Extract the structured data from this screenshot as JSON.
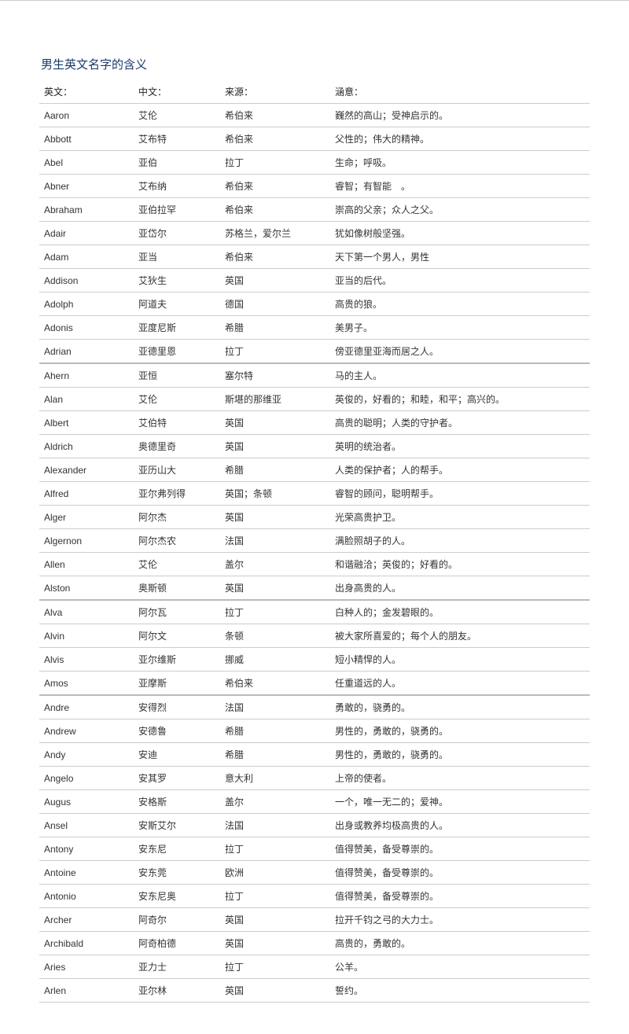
{
  "title": "男生英文名字的含义",
  "headers": {
    "en": "英文：",
    "cn": "中文：",
    "src": "来源：",
    "mean": "涵意："
  },
  "rows": [
    {
      "en": "Aaron",
      "cn": "艾伦",
      "src": "希伯来",
      "mean": "巍然的高山；受神启示的。",
      "sep": false
    },
    {
      "en": "Abbott",
      "cn": "艾布特",
      "src": "希伯来",
      "mean": "父性的；伟大的精神。",
      "sep": false
    },
    {
      "en": "Abel",
      "cn": "亚伯",
      "src": "拉丁",
      "mean": "生命；呼吸。",
      "sep": false
    },
    {
      "en": "Abner",
      "cn": "艾布纳",
      "src": "希伯来",
      "mean": "睿智；有智能　。",
      "sep": false
    },
    {
      "en": "Abraham",
      "cn": "亚伯拉罕",
      "src": "希伯来",
      "mean": "崇高的父亲；众人之父。",
      "sep": false
    },
    {
      "en": "Adair",
      "cn": "亚岱尔",
      "src": "苏格兰，爱尔兰",
      "mean": "犹如像树般坚强。",
      "sep": false
    },
    {
      "en": "Adam",
      "cn": "亚当",
      "src": "希伯来",
      "mean": "天下第一个男人，男性",
      "sep": false
    },
    {
      "en": "Addison",
      "cn": "艾狄生",
      "src": "英国",
      "mean": "亚当的后代。",
      "sep": false
    },
    {
      "en": "Adolph",
      "cn": "阿道夫",
      "src": "德国",
      "mean": "高贵的狼。",
      "sep": false
    },
    {
      "en": "Adonis",
      "cn": "亚度尼斯",
      "src": "希腊",
      "mean": "美男子。",
      "sep": false
    },
    {
      "en": "Adrian",
      "cn": "亚德里恩",
      "src": "拉丁",
      "mean": "傍亚德里亚海而居之人。",
      "sep": true
    },
    {
      "en": "Ahern",
      "cn": "亚恒",
      "src": "塞尔特",
      "mean": "马的主人。",
      "sep": false
    },
    {
      "en": "Alan",
      "cn": "艾伦",
      "src": "斯堪的那维亚",
      "mean": "英俊的，好看的；和睦，和平；高兴的。",
      "sep": false
    },
    {
      "en": "Albert",
      "cn": "艾伯特",
      "src": "英国",
      "mean": "高贵的聪明；人类的守护者。",
      "sep": false
    },
    {
      "en": "Aldrich",
      "cn": "奥德里奇",
      "src": "英国",
      "mean": "英明的统治者。",
      "sep": false
    },
    {
      "en": "Alexander",
      "cn": "亚历山大",
      "src": "希腊",
      "mean": "人类的保护者；人的帮手。",
      "sep": false
    },
    {
      "en": "Alfred",
      "cn": "亚尔弗列得",
      "src": "英国；条顿",
      "mean": "睿智的顾问，聪明帮手。",
      "sep": false
    },
    {
      "en": "Alger",
      "cn": "阿尔杰",
      "src": "英国",
      "mean": "光荣高贵护卫。",
      "sep": false
    },
    {
      "en": "Algernon",
      "cn": "阿尔杰农",
      "src": "法国",
      "mean": "满脸照胡子的人。",
      "sep": false
    },
    {
      "en": "Allen",
      "cn": "艾伦",
      "src": "盖尔",
      "mean": "和谐融洽；英俊的；好看的。",
      "sep": false
    },
    {
      "en": "Alston",
      "cn": "奥斯顿",
      "src": "英国",
      "mean": "出身高贵的人。",
      "sep": true
    },
    {
      "en": "Alva",
      "cn": "阿尔瓦",
      "src": "拉丁",
      "mean": "白种人的；金发碧眼的。",
      "sep": false
    },
    {
      "en": "Alvin",
      "cn": "阿尔文",
      "src": "条顿",
      "mean": "被大家所喜爱的；每个人的朋友。",
      "sep": false
    },
    {
      "en": "Alvis",
      "cn": "亚尔维斯",
      "src": "挪威",
      "mean": "短小精悍的人。",
      "sep": false
    },
    {
      "en": "Amos",
      "cn": "亚摩斯",
      "src": "希伯来",
      "mean": "任重道远的人。",
      "sep": true
    },
    {
      "en": "Andre",
      "cn": "安得烈",
      "src": "法国",
      "mean": "勇敢的，骁勇的。",
      "sep": false
    },
    {
      "en": "Andrew",
      "cn": "安德鲁",
      "src": "希腊",
      "mean": "男性的，勇敢的，骁勇的。",
      "sep": false
    },
    {
      "en": "Andy",
      "cn": "安迪",
      "src": "希腊",
      "mean": "男性的，勇敢的，骁勇的。",
      "sep": false
    },
    {
      "en": "Angelo",
      "cn": "安其罗",
      "src": "意大利",
      "mean": "上帝的使者。",
      "sep": false
    },
    {
      "en": "Augus",
      "cn": "安格斯",
      "src": "盖尔",
      "mean": "一个，唯一无二的；爱神。",
      "sep": false
    },
    {
      "en": "Ansel",
      "cn": "安斯艾尔",
      "src": "法国",
      "mean": "出身或教养均极高贵的人。",
      "sep": false
    },
    {
      "en": "Antony",
      "cn": "安东尼",
      "src": "拉丁",
      "mean": "值得赞美，备受尊崇的。",
      "sep": false
    },
    {
      "en": "Antoine",
      "cn": "安东莞",
      "src": "欧洲",
      "mean": "值得赞美，备受尊崇的。",
      "sep": false
    },
    {
      "en": "Antonio",
      "cn": "安东尼奥",
      "src": "拉丁",
      "mean": "值得赞美，备受尊崇的。",
      "sep": false
    },
    {
      "en": "Archer",
      "cn": "阿奇尔",
      "src": "英国",
      "mean": "拉开千钧之弓的大力士。",
      "sep": false
    },
    {
      "en": "Archibald",
      "cn": "阿奇柏德",
      "src": "英国",
      "mean": "高贵的，勇敢的。",
      "sep": false
    },
    {
      "en": "Aries",
      "cn": "亚力士",
      "src": "拉丁",
      "mean": "公羊。",
      "sep": false
    },
    {
      "en": "Arlen",
      "cn": "亚尔林",
      "src": "英国",
      "mean": "誓约。",
      "sep": false
    }
  ]
}
